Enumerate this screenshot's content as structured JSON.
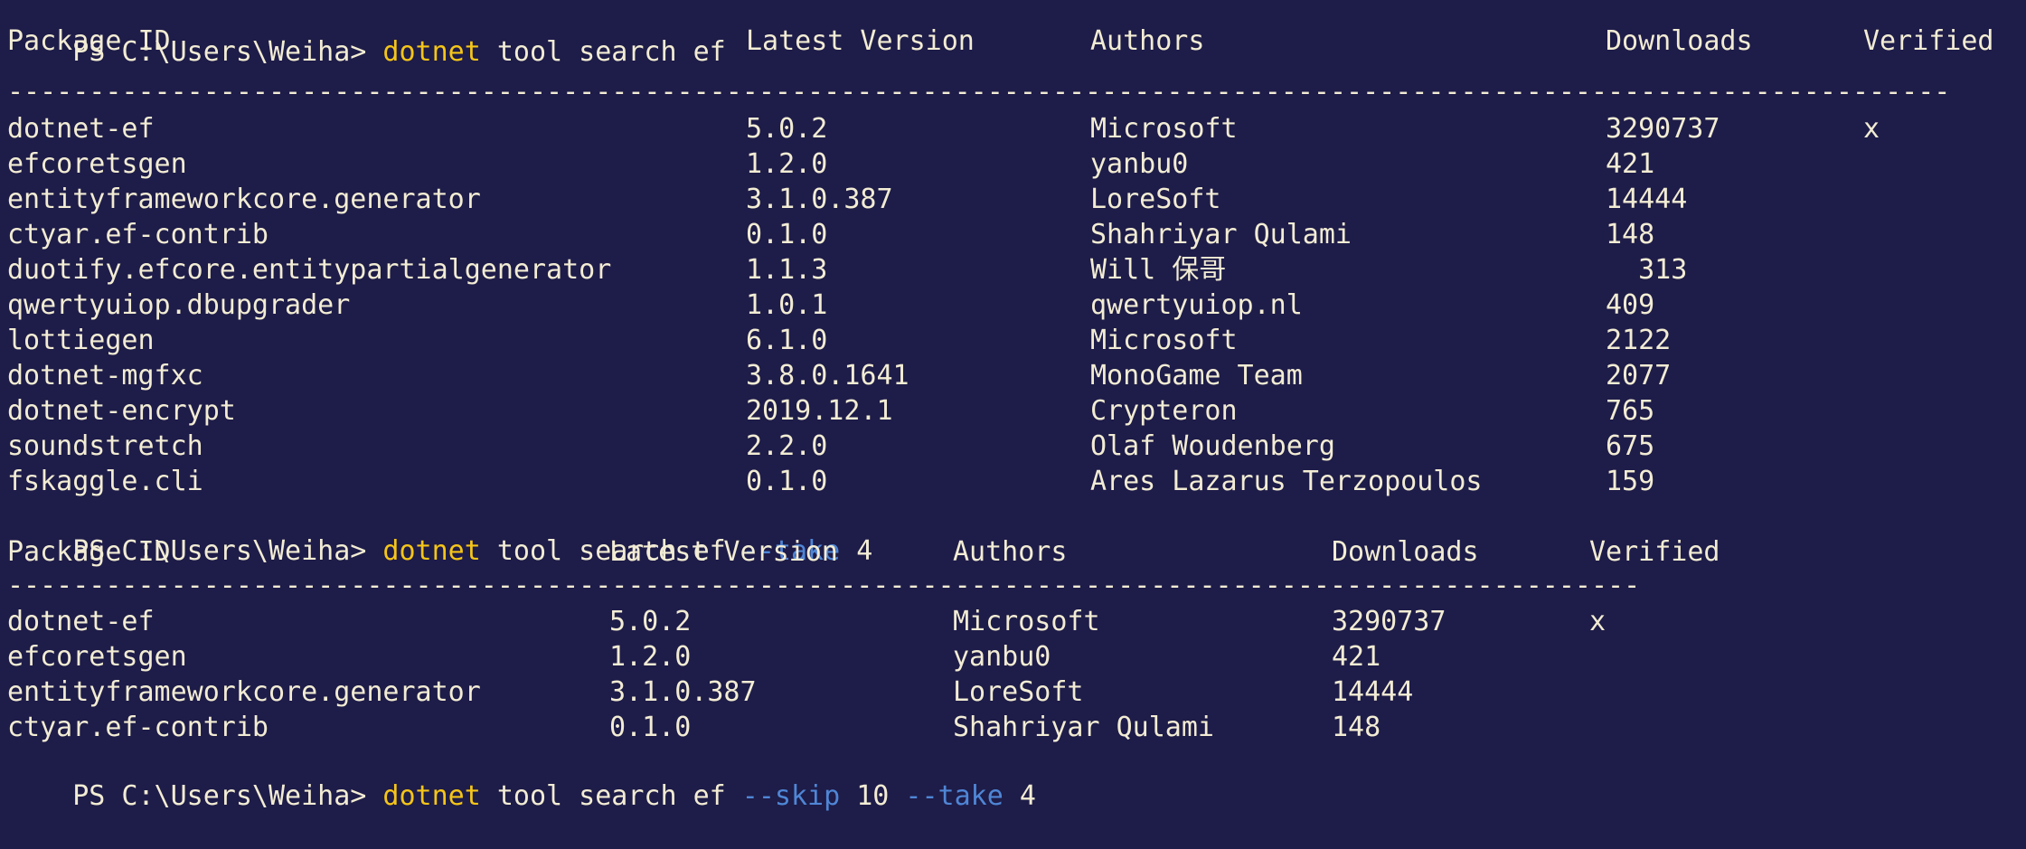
{
  "terminal": {
    "prompt": "PS C:\\Users\\Weiha> ",
    "commands": [
      {
        "program": "dotnet",
        "args": " tool search ef",
        "flags": []
      },
      {
        "program": "dotnet",
        "args": " tool search ef ",
        "flags": [
          {
            "flag": "--take",
            "value": " 4"
          }
        ]
      },
      {
        "program": "dotnet",
        "args": " tool search ef ",
        "flags": [
          {
            "flag": "--skip",
            "value": " 10 "
          },
          {
            "flag": "--take",
            "value": " 4"
          }
        ]
      }
    ],
    "colors": {
      "background": "#1e1c48",
      "text": "#f2ecd4",
      "command": "#f5c518",
      "flag": "#4f86d6"
    },
    "table1": {
      "headers": [
        "Package ID",
        "Latest Version",
        "Authors",
        "Downloads",
        "Verified"
      ],
      "separator": "-----------------------------------------------------------------------------------------------------------------------",
      "rows": [
        [
          "dotnet-ef",
          "5.0.2",
          "Microsoft",
          "3290737",
          "x"
        ],
        [
          "efcoretsgen",
          "1.2.0",
          "yanbu0",
          "421",
          ""
        ],
        [
          "entityframeworkcore.generator",
          "3.1.0.387",
          "LoreSoft",
          "14444",
          ""
        ],
        [
          "ctyar.ef-contrib",
          "0.1.0",
          "Shahriyar Qulami",
          "148",
          ""
        ],
        [
          "duotify.efcore.entitypartialgenerator",
          "1.1.3",
          "Will 保哥",
          "  313",
          ""
        ],
        [
          "qwertyuiop.dbupgrader",
          "1.0.1",
          "qwertyuiop.nl",
          "409",
          ""
        ],
        [
          "lottiegen",
          "6.1.0",
          "Microsoft",
          "2122",
          ""
        ],
        [
          "dotnet-mgfxc",
          "3.8.0.1641",
          "MonoGame Team",
          "2077",
          ""
        ],
        [
          "dotnet-encrypt",
          "2019.12.1",
          "Crypteron",
          "765",
          ""
        ],
        [
          "soundstretch",
          "2.2.0",
          "Olaf Woudenberg",
          "675",
          ""
        ],
        [
          "fskaggle.cli",
          "0.1.0",
          "Ares Lazarus Terzopoulos",
          "159",
          ""
        ]
      ]
    },
    "table2": {
      "headers": [
        "Package ID",
        "Latest Version",
        "Authors",
        "Downloads",
        "Verified"
      ],
      "separator": "----------------------------------------------------------------------------------------------------",
      "rows": [
        [
          "dotnet-ef",
          "5.0.2",
          "Microsoft",
          "3290737",
          "x"
        ],
        [
          "efcoretsgen",
          "1.2.0",
          "yanbu0",
          "421",
          ""
        ],
        [
          "entityframeworkcore.generator",
          "3.1.0.387",
          "LoreSoft",
          "14444",
          ""
        ],
        [
          "ctyar.ef-contrib",
          "0.1.0",
          "Shahriyar Qulami",
          "148",
          ""
        ]
      ]
    }
  }
}
